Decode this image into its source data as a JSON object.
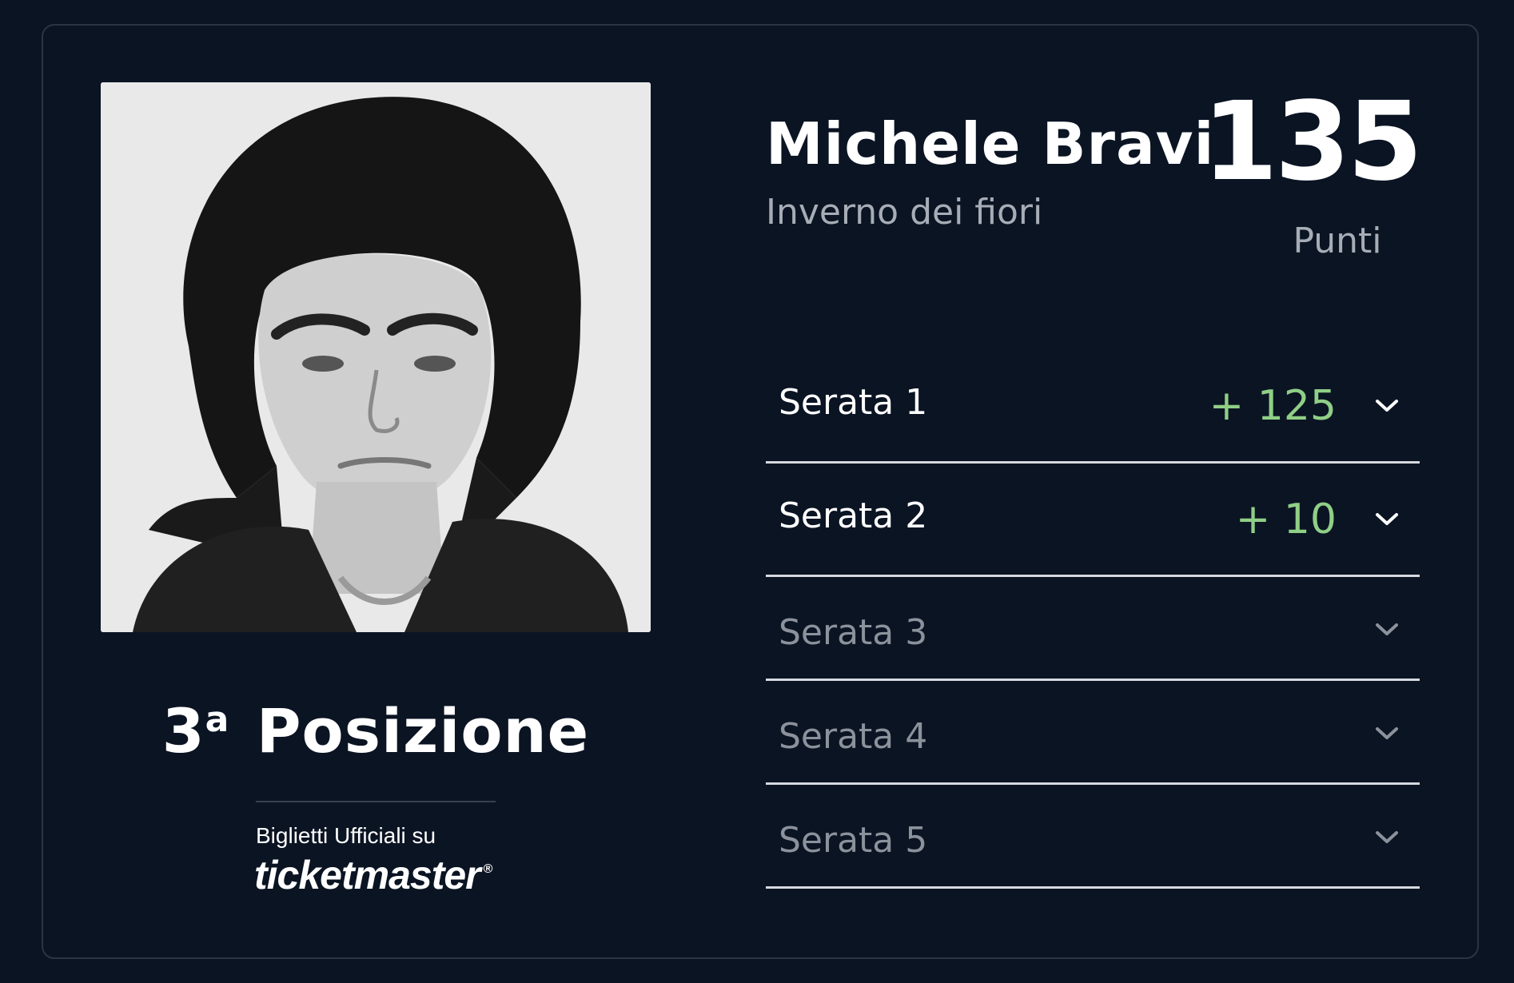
{
  "artist": {
    "name": "Michele Bravi",
    "song": "Inverno dei fiori",
    "photo_icon": "artist-portrait"
  },
  "points": {
    "value": "135",
    "label": "Punti"
  },
  "position": {
    "number": "3",
    "ordinal": "a",
    "label": "Posizione"
  },
  "sponsor": {
    "caption": "Biglietti Ufficiali su",
    "logo": "ticketmaster",
    "registered": "®"
  },
  "rounds": [
    {
      "label": "Serata 1",
      "score": "+ 125",
      "active": true,
      "icon": "chevron-down-icon"
    },
    {
      "label": "Serata 2",
      "score": "+ 10",
      "active": true,
      "icon": "chevron-down-icon"
    },
    {
      "label": "Serata 3",
      "score": "",
      "active": false,
      "icon": "chevron-down-icon"
    },
    {
      "label": "Serata 4",
      "score": "",
      "active": false,
      "icon": "chevron-down-icon"
    },
    {
      "label": "Serata 5",
      "score": "",
      "active": false,
      "icon": "chevron-down-icon"
    }
  ],
  "colors": {
    "background": "#0b1423",
    "score_green": "#8fcf86",
    "muted_text": "#a7adb6",
    "divider": "#d6d9de"
  }
}
